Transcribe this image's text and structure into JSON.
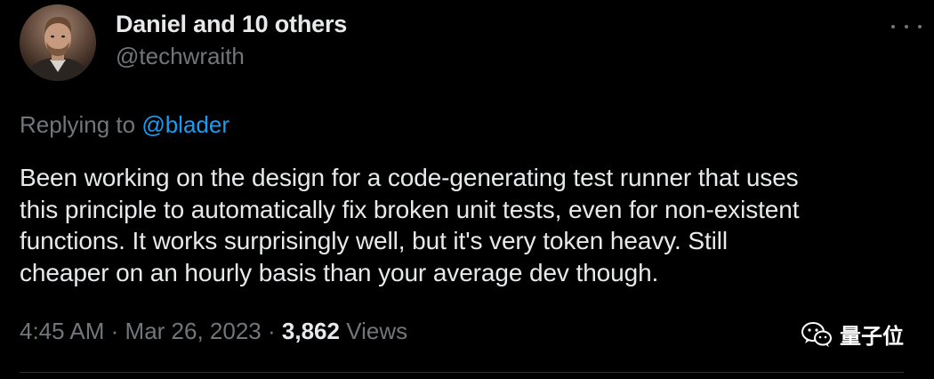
{
  "tweet": {
    "author": {
      "display_name": "Daniel and 10 others",
      "handle": "@techwraith"
    },
    "replying": {
      "prefix": "Replying to",
      "mention": "@blader"
    },
    "text_lines": [
      "Been working on the design for a code-generating test runner that uses",
      "this principle to automatically fix broken unit tests, even for non-existent",
      "functions. It works surprisingly well, but it's very token heavy. Still",
      "cheaper on an hourly basis than your average dev though."
    ],
    "meta": {
      "time": "4:45 AM",
      "separator": "·",
      "date": "Mar 26, 2023",
      "views_count": "3,862",
      "views_label": "Views"
    }
  },
  "watermark": {
    "text": "量子位"
  },
  "colors": {
    "background": "#000000",
    "primary_text": "#e7e9ea",
    "secondary_text": "#71767b",
    "link": "#1d9bf0"
  },
  "icons": {
    "more": "more-horizontal-icon",
    "watermark_logo": "wechat-icon"
  }
}
